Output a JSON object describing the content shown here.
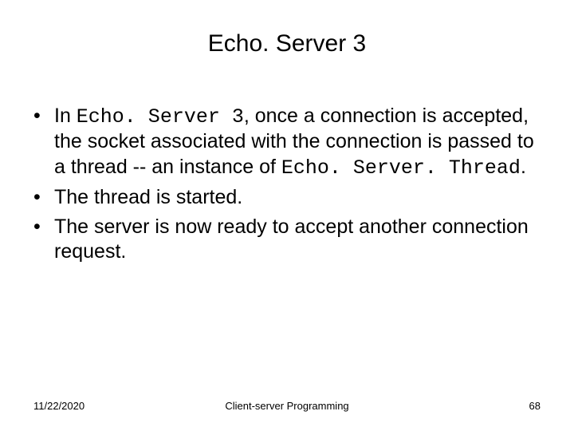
{
  "title": "Echo. Server 3",
  "bullets": [
    {
      "pre": "In ",
      "code1": "Echo. Server 3",
      "mid": ", once a connection is accepted, the socket associated with the connection is passed to a thread -- an instance of ",
      "code2": "Echo. Server. Thread",
      "post": "."
    },
    {
      "text": "The thread is started."
    },
    {
      "text": "The server is now ready to accept another connection request."
    }
  ],
  "footer": {
    "date": "11/22/2020",
    "center": "Client-server Programming",
    "page": "68"
  }
}
